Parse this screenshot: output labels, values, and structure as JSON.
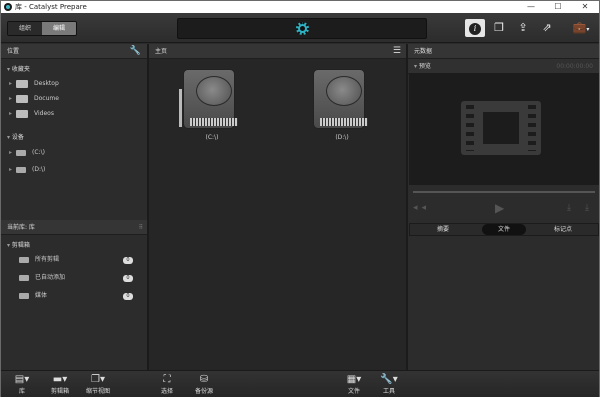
{
  "window": {
    "title": "库 - Catalyst Prepare"
  },
  "toolbar": {
    "segments": {
      "organize": "组织",
      "edit": "编辑"
    }
  },
  "left_panel": {
    "header": "位置",
    "favorites_label": "收藏夹",
    "favorites": [
      "Desktop",
      "Docume",
      "Videos"
    ],
    "devices_label": "设备",
    "devices": [
      "(C:\\)",
      "(D:\\)"
    ],
    "library_header": "当前库: 库",
    "bins_label": "剪辑箱",
    "bins": [
      {
        "label": "所有剪辑",
        "count": "0"
      },
      {
        "label": "已自动添加",
        "count": "0"
      },
      {
        "label": "媒体",
        "count": "0"
      }
    ]
  },
  "center_panel": {
    "header": "主页",
    "drives": [
      "(C:\\)",
      "(D:\\)"
    ]
  },
  "right_panel": {
    "header": "元数据",
    "preview_label": "预览",
    "timecode": "00:00:00:00",
    "tabs": [
      "摘要",
      "文件",
      "标记点"
    ]
  },
  "bottom_bar": {
    "library": "库",
    "storyboard": "剪辑箱",
    "detail_view": "缩节视图",
    "select": "选择",
    "backup": "备份源",
    "file": "文件",
    "tools": "工具"
  }
}
